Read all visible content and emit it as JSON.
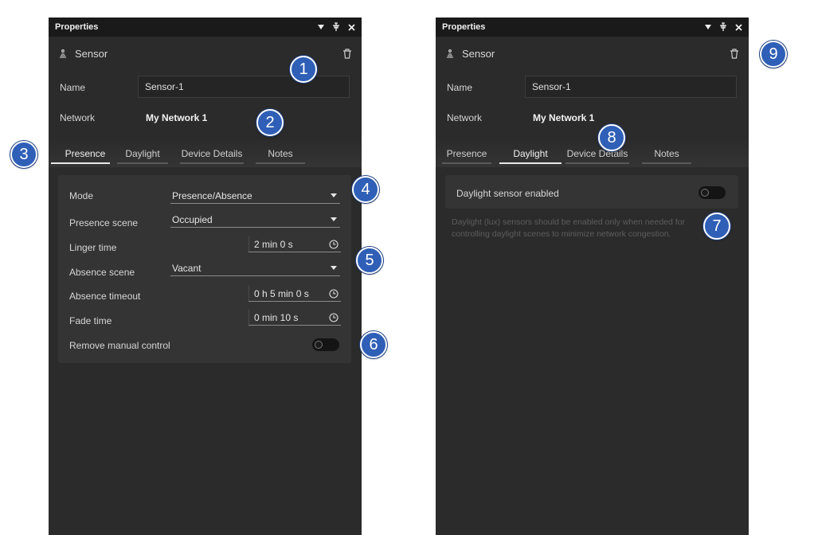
{
  "panels": [
    {
      "title": "Properties",
      "device_name": "Sensor",
      "fields": {
        "name_label": "Name",
        "name_value": "Sensor-1",
        "network_label": "Network",
        "network_value": "My Network 1"
      },
      "tabs": [
        "Presence",
        "Daylight",
        "Device Details",
        "Notes"
      ],
      "active_tab": "Presence",
      "presence": {
        "mode_label": "Mode",
        "mode_value": "Presence/Absence",
        "presence_scene_label": "Presence scene",
        "presence_scene_value": "Occupied",
        "linger_label": "Linger time",
        "linger_value": "2 min 0 s",
        "absence_scene_label": "Absence scene",
        "absence_scene_value": "Vacant",
        "absence_timeout_label": "Absence timeout",
        "absence_timeout_value": "0 h 5 min 0 s",
        "fade_label": "Fade time",
        "fade_value": "0 min 10 s",
        "remove_manual_label": "Remove manual control",
        "remove_manual_on": false
      }
    },
    {
      "title": "Properties",
      "device_name": "Sensor",
      "fields": {
        "name_label": "Name",
        "name_value": "Sensor-1",
        "network_label": "Network",
        "network_value": "My Network 1"
      },
      "tabs": [
        "Presence",
        "Daylight",
        "Device Details",
        "Notes"
      ],
      "active_tab": "Daylight",
      "daylight": {
        "enabled_label": "Daylight sensor enabled",
        "enabled_on": false,
        "helper_text": "Daylight (lux) sensors should be enabled only when needed for controlling daylight scenes to minimize network congestion."
      }
    }
  ],
  "callouts": [
    "1",
    "2",
    "3",
    "4",
    "5",
    "6",
    "7",
    "8",
    "9"
  ],
  "colors": {
    "panel_bg": "#2b2b2b",
    "titlebar_bg": "#1a1a1a",
    "card_bg": "#343434",
    "badge_blue": "#2f5fb6"
  }
}
